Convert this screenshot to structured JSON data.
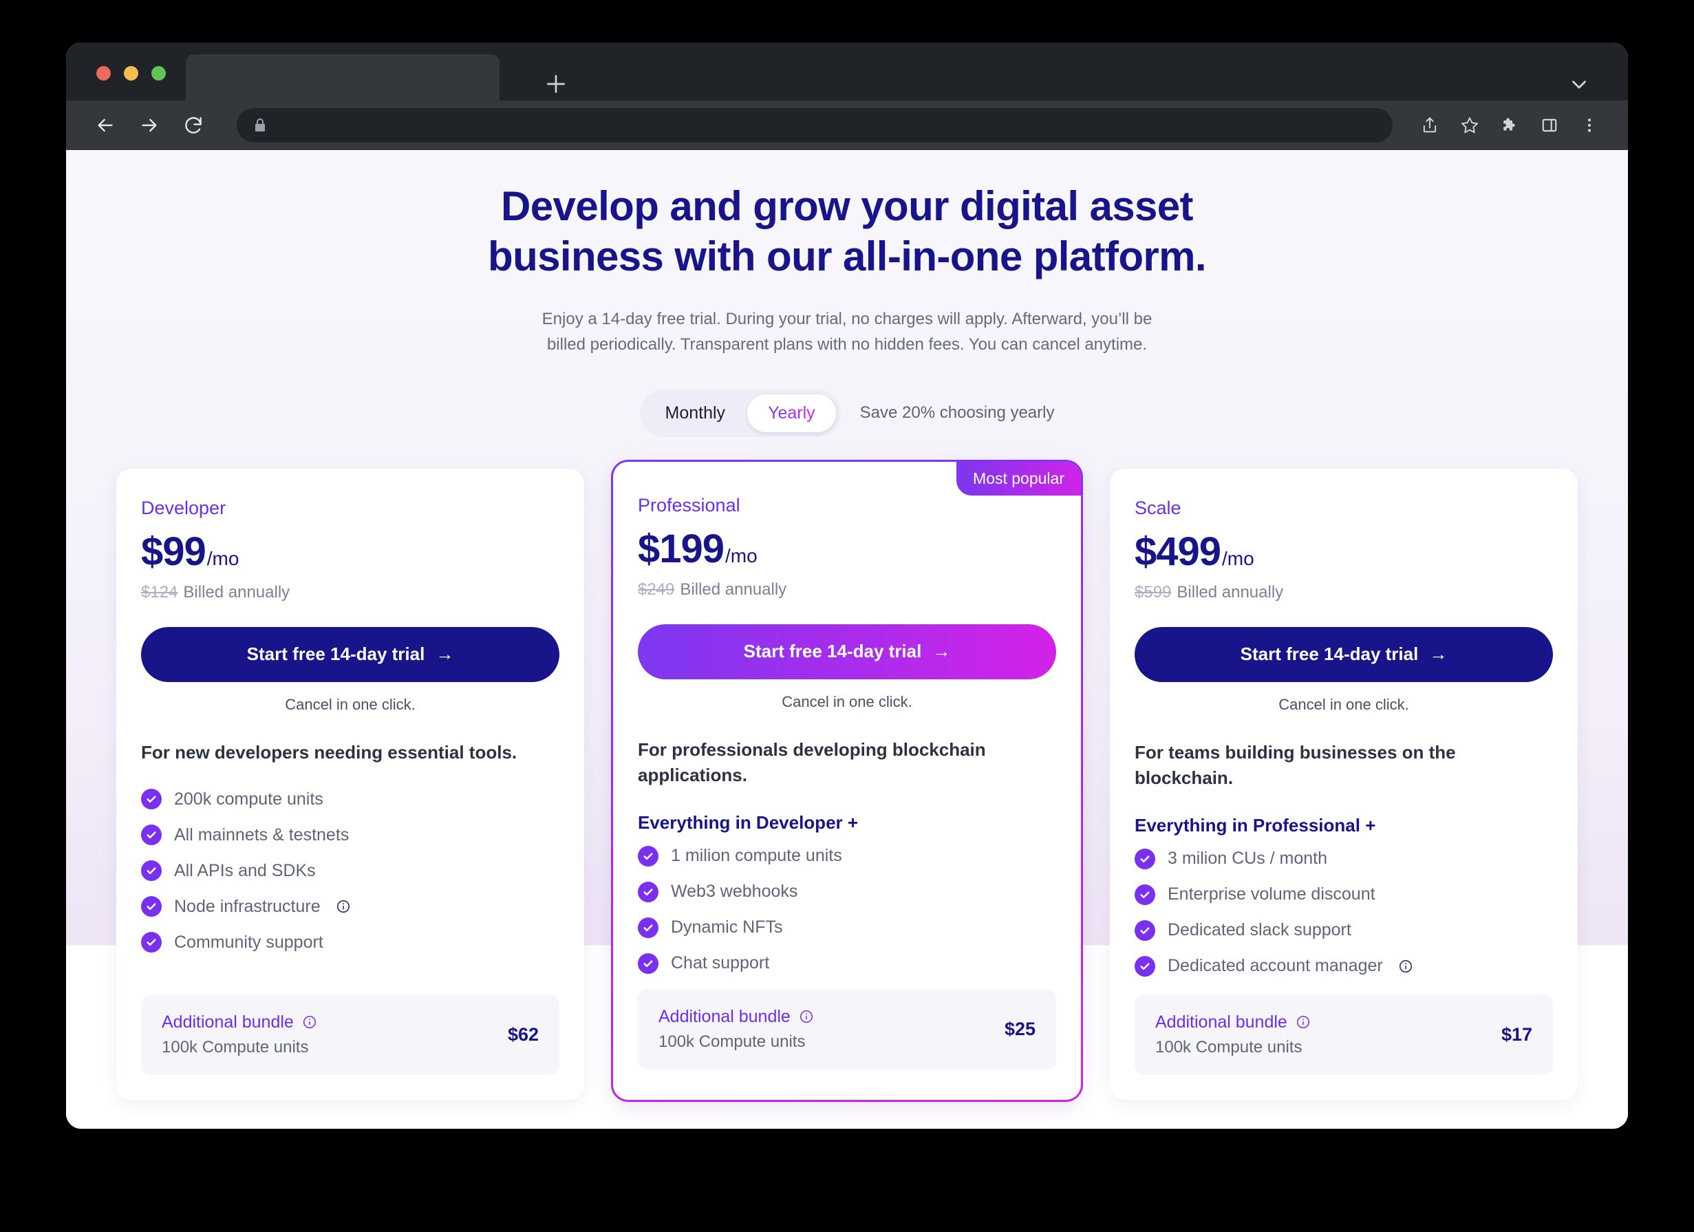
{
  "browser": {
    "tab_title": "",
    "url": "",
    "url_placeholder": "",
    "icons": {
      "back": "back-arrow-icon",
      "forward": "forward-arrow-icon",
      "reload": "reload-icon",
      "lock": "lock-icon",
      "new_tab": "plus-icon",
      "tab_list": "chevron-down-icon",
      "share": "share-icon",
      "bookmark": "star-icon",
      "extensions": "puzzle-icon",
      "side_panel": "side-panel-icon",
      "menu": "three-dot-menu-icon"
    }
  },
  "hero": {
    "title_line1": "Develop and grow your digital asset",
    "title_line2": "business with our all-in-one platform.",
    "subtitle_line1": "Enjoy a 14-day free trial. During your trial, no charges will apply. Afterward, you’ll be",
    "subtitle_line2": "billed periodically. Transparent plans with no hidden fees. You can cancel anytime."
  },
  "billing_toggle": {
    "monthly_label": "Monthly",
    "yearly_label": "Yearly",
    "selected": "Yearly",
    "save_note": "Save 20% choosing yearly"
  },
  "colors": {
    "brand_navy": "#181489",
    "brand_purple": "#7b2ff0",
    "brand_magenta": "#d322e8",
    "text_muted": "#5e6479",
    "card_bg": "#ffffff",
    "bundle_bg": "#f6f6fa"
  },
  "plans": [
    {
      "name": "Developer",
      "price": "$99",
      "per": "/mo",
      "old_price": "$124",
      "billed_text": "Billed annually",
      "cta_label": "Start free 14-day trial",
      "cta_arrow": "→",
      "cancel_note": "Cancel in one click.",
      "description": "For new developers needing essential tools.",
      "everything_label": "",
      "features": [
        {
          "label": "200k compute units",
          "info": false
        },
        {
          "label": "All mainnets & testnets",
          "info": false
        },
        {
          "label": "All APIs and SDKs",
          "info": false
        },
        {
          "label": "Node infrastructure",
          "info": true
        },
        {
          "label": "Community support",
          "info": false
        }
      ],
      "bundle": {
        "title": "Additional bundle",
        "subtitle": "100k Compute units",
        "price": "$62"
      },
      "featured": false,
      "badge": ""
    },
    {
      "name": "Professional",
      "price": "$199",
      "per": "/mo",
      "old_price": "$249",
      "billed_text": "Billed annually",
      "cta_label": "Start free 14-day trial",
      "cta_arrow": "→",
      "cancel_note": "Cancel in one click.",
      "description": "For professionals developing blockchain applications.",
      "everything_label": "Everything in Developer +",
      "features": [
        {
          "label": "1 milion compute units",
          "info": false
        },
        {
          "label": "Web3 webhooks",
          "info": false
        },
        {
          "label": "Dynamic NFTs",
          "info": false
        },
        {
          "label": "Chat support",
          "info": false
        }
      ],
      "bundle": {
        "title": "Additional bundle",
        "subtitle": "100k Compute units",
        "price": "$25"
      },
      "featured": true,
      "badge": "Most popular"
    },
    {
      "name": "Scale",
      "price": "$499",
      "per": "/mo",
      "old_price": "$599",
      "billed_text": "Billed annually",
      "cta_label": "Start free 14-day trial",
      "cta_arrow": "→",
      "cancel_note": "Cancel in one click.",
      "description": "For teams building businesses on the blockchain.",
      "everything_label": "Everything in Professional +",
      "features": [
        {
          "label": "3 milion CUs / month",
          "info": false
        },
        {
          "label": "Enterprise volume discount",
          "info": false
        },
        {
          "label": "Dedicated slack support",
          "info": false
        },
        {
          "label": "Dedicated account manager",
          "info": true
        }
      ],
      "bundle": {
        "title": "Additional bundle",
        "subtitle": "100k Compute units",
        "price": "$17"
      },
      "featured": false,
      "badge": ""
    }
  ]
}
